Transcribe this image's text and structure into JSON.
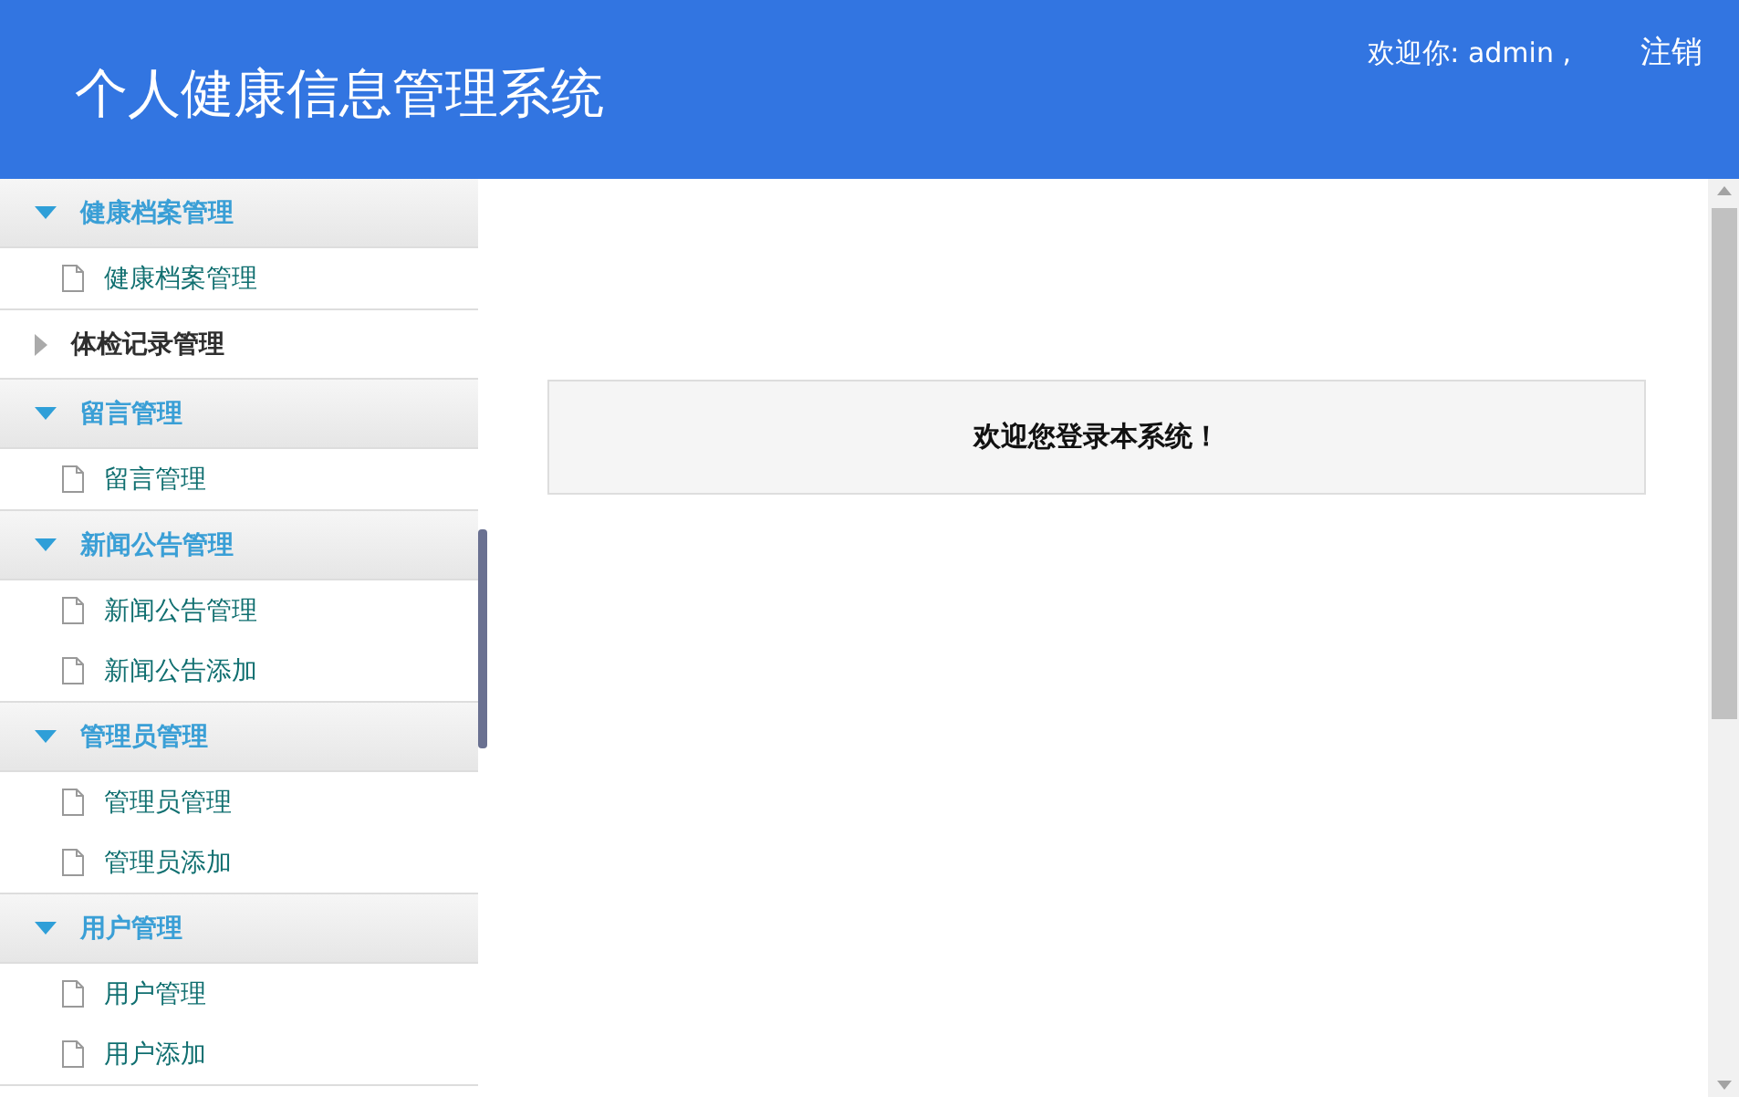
{
  "header": {
    "title": "个人健康信息管理系统",
    "greeting": "欢迎你: admin ,",
    "logout": "注销"
  },
  "sidebar": {
    "groups": [
      {
        "title": "健康档案管理",
        "expanded": true,
        "items": [
          "健康档案管理"
        ]
      },
      {
        "title": "体检记录管理",
        "expanded": false
      },
      {
        "title": "留言管理",
        "expanded": true,
        "items": [
          "留言管理"
        ]
      },
      {
        "title": "新闻公告管理",
        "expanded": true,
        "items": [
          "新闻公告管理",
          "新闻公告添加"
        ]
      },
      {
        "title": "管理员管理",
        "expanded": true,
        "items": [
          "管理员管理",
          "管理员添加"
        ]
      },
      {
        "title": "用户管理",
        "expanded": true,
        "items": [
          "用户管理",
          "用户添加"
        ]
      }
    ]
  },
  "main": {
    "welcome": "欢迎您登录本系统！"
  }
}
